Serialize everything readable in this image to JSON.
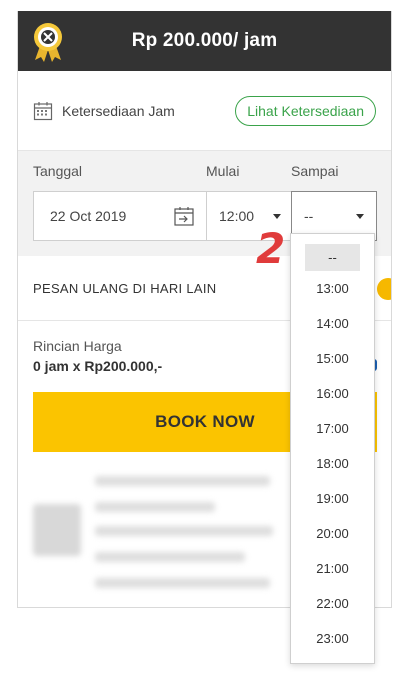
{
  "header": {
    "price_label": "Rp 200.000/ jam"
  },
  "availability": {
    "label": "Ketersediaan Jam",
    "button_label": "Lihat Ketersediaan"
  },
  "time_form": {
    "date_label": "Tanggal",
    "start_label": "Mulai",
    "end_label": "Sampai",
    "date_value": "22 Oct 2019",
    "start_value": "12:00",
    "end_value": "--"
  },
  "reorder": {
    "label": "PESAN ULANG DI HARI LAIN"
  },
  "price_detail": {
    "title": "Rincian Harga",
    "summary": "0 jam x Rp200.000,-"
  },
  "book": {
    "label": "BOOK NOW"
  },
  "dropdown": {
    "selected": "--",
    "options": [
      "13:00",
      "14:00",
      "15:00",
      "16:00",
      "17:00",
      "18:00",
      "19:00",
      "20:00",
      "21:00",
      "22:00",
      "23:00"
    ]
  },
  "annotation": {
    "text": "2"
  },
  "colors": {
    "header_bg": "#333333",
    "accent_yellow": "#fbc400",
    "accent_green": "#3aa34a",
    "annotation_red": "#e03b3b"
  },
  "icons": [
    "award-badge-icon",
    "calendar-grid-icon",
    "calendar-arrow-icon",
    "caret-down-icon"
  ]
}
